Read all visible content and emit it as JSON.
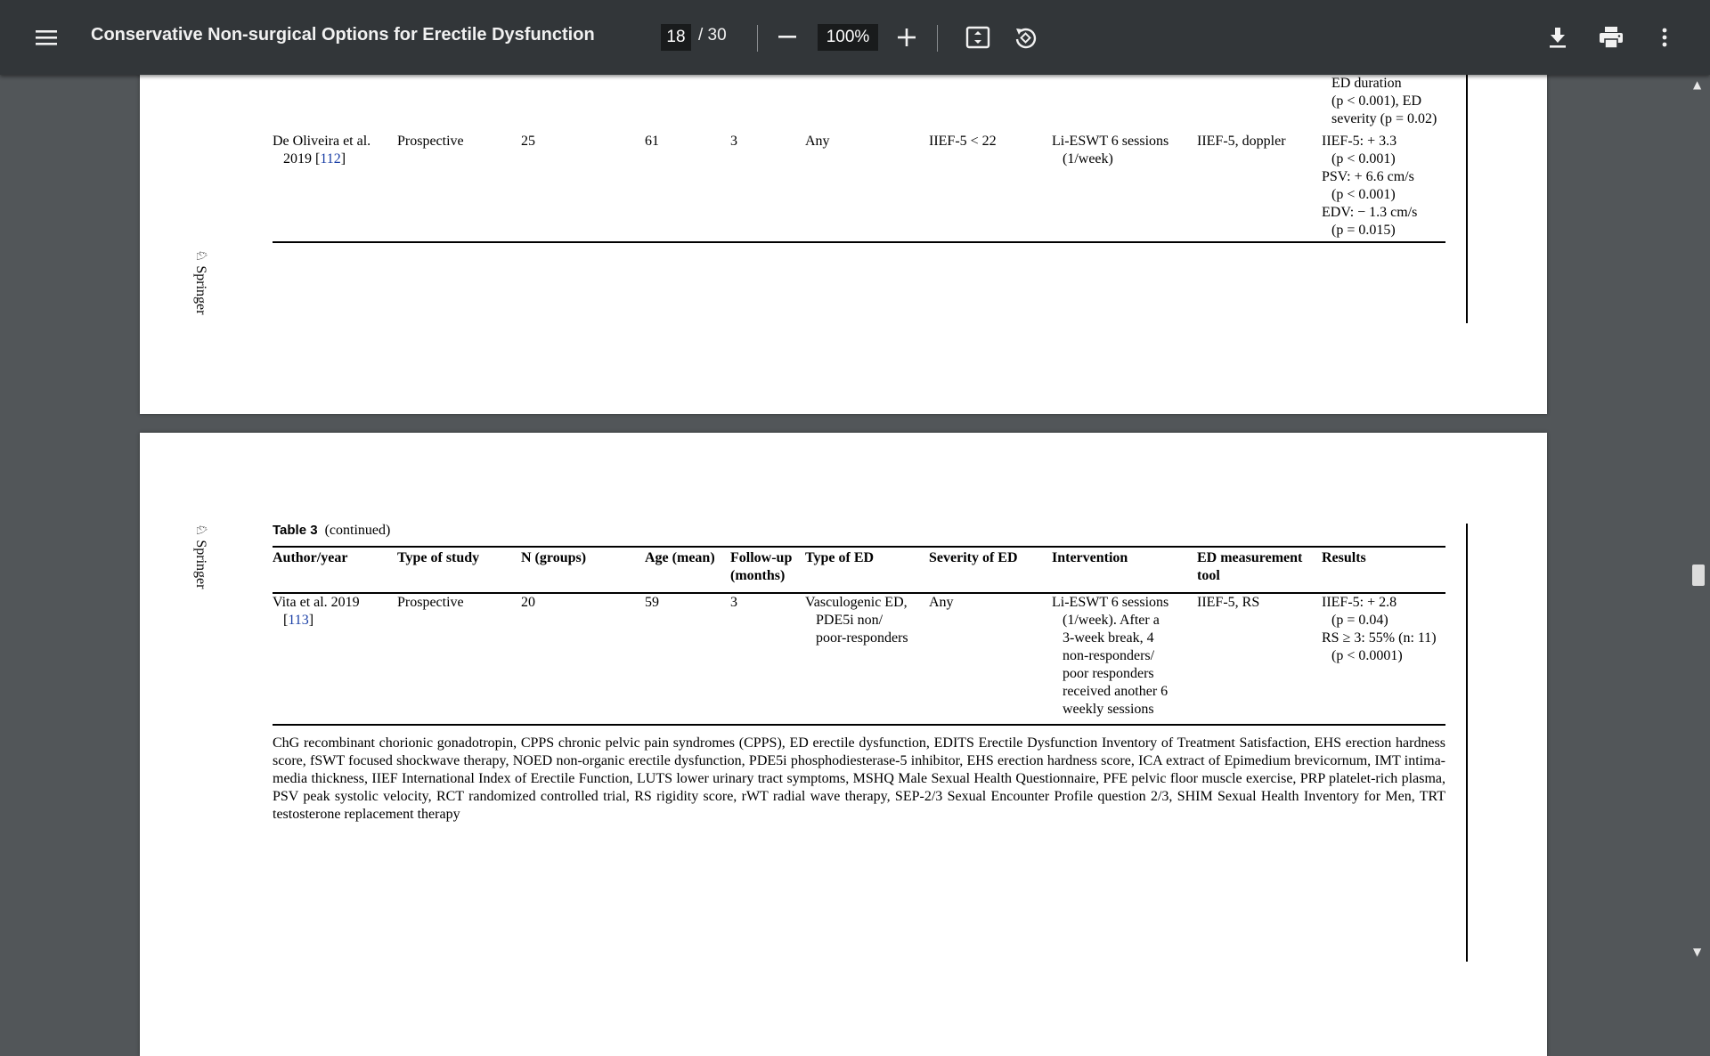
{
  "toolbar": {
    "title": "Conservative Non-surgical Options for Erectile Dysfunction",
    "page_current": "18",
    "page_total": "/ 30",
    "zoom": "100%",
    "icons": [
      "menu-icon",
      "zoom-out-icon",
      "zoom-in-icon",
      "fit-page-icon",
      "rotate-icon",
      "download-icon",
      "print-icon",
      "more-icon"
    ]
  },
  "page1": {
    "results_cont": [
      "ED duration",
      "(p < 0.001), ED",
      "severity (p = 0.02)"
    ],
    "row": {
      "author": [
        "De Oliveira et al.",
        "2019 [",
        "112",
        "]"
      ],
      "type": "Prospective",
      "n": "25",
      "age": "61",
      "followup": "3",
      "ed_type": "Any",
      "severity": "IIEF-5 < 22",
      "intervention": [
        "Li-ESWT 6 sessions",
        "(1/week)"
      ],
      "tool": "IIEF-5, doppler",
      "results": [
        "IIEF-5: + 3.3",
        "(p < 0.001)",
        "PSV: + 6.6 cm/s",
        "(p < 0.001)",
        "EDV: − 1.3 cm/s",
        "(p = 0.015)"
      ]
    },
    "springer": "Springer"
  },
  "page2": {
    "springer": "Springer",
    "caption_label": "Table 3",
    "caption_text": "(continued)",
    "headers": {
      "author": "Author/year",
      "type": "Type of study",
      "n": "N (groups)",
      "age": "Age (mean)",
      "followup": [
        "Follow-up",
        "(months)"
      ],
      "ed_type": "Type of ED",
      "severity": "Severity of ED",
      "intervention": "Intervention",
      "tool": [
        "ED measurement",
        "tool"
      ],
      "results": "Results"
    },
    "row": {
      "author": [
        "Vita et al. 2019",
        "[",
        "113",
        "]"
      ],
      "type": "Prospective",
      "n": "20",
      "age": "59",
      "followup": "3",
      "ed_type": [
        "Vasculogenic ED,",
        "PDE5i non/",
        "poor-responders"
      ],
      "severity": "Any",
      "intervention": [
        "Li-ESWT 6 sessions",
        "(1/week). After a",
        "3-week break, 4",
        "non-responders/",
        "poor responders",
        "received another 6",
        "weekly sessions"
      ],
      "tool": "IIEF-5, RS",
      "results": [
        "IIEF-5: + 2.8",
        "(p = 0.04)",
        "RS ≥ 3: 55% (n: 11)",
        "(p < 0.0001)"
      ]
    },
    "footnote": "ChG recombinant chorionic gonadotropin, CPPS chronic pelvic pain syndromes (CPPS), ED erectile dysfunction, EDITS Erectile Dysfunction Inventory of Treatment Satisfaction, EHS erection hardness score, fSWT focused shockwave therapy, NOED non-organic erectile dysfunction, PDE5i phosphodiesterase-5 inhibitor, EHS erection hardness score, ICA extract of Epimedium brevicornum, IMT intima-media thickness, IIEF International Index of Erectile Function, LUTS lower urinary tract symptoms, MSHQ Male Sexual Health Questionnaire, PFE pelvic floor muscle exercise, PRP platelet-rich plasma, PSV peak systolic velocity, RCT randomized controlled trial, RS rigidity score, rWT radial wave therapy, SEP-2/3 Sexual Encounter Profile question 2/3, SHIM Sexual Health Inventory for Men, TRT testosterone replacement therapy"
  }
}
